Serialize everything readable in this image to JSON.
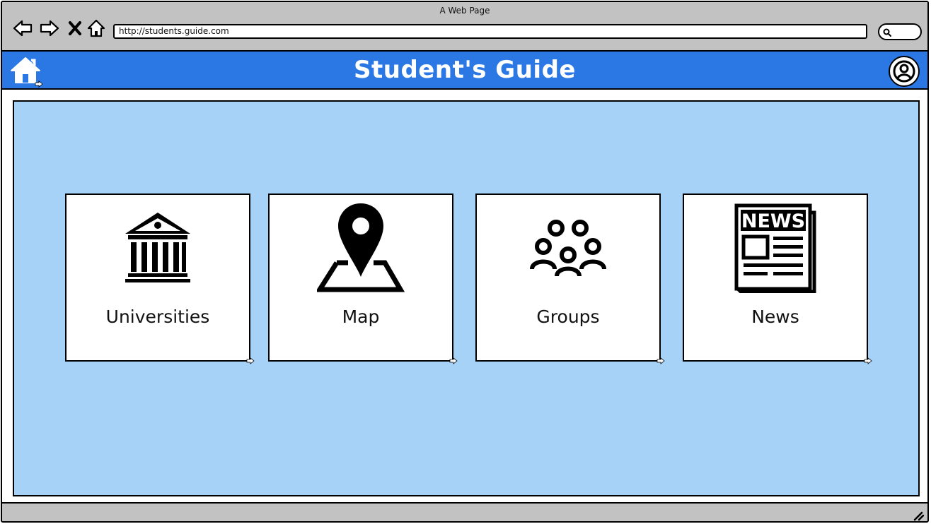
{
  "browser": {
    "window_title": "A Web Page",
    "url": "http://students.guide.com",
    "nav": {
      "back_icon": "arrow-left-icon",
      "forward_icon": "arrow-right-icon",
      "stop_icon": "close-icon",
      "home_icon": "home-icon",
      "search_icon": "search-icon"
    }
  },
  "header": {
    "title": "Student's Guide",
    "home_icon": "home-icon",
    "profile_icon": "user-circle-icon",
    "background_color": "#2b78e4"
  },
  "content": {
    "background_color": "#a7d2f7",
    "tiles": [
      {
        "label": "Universities",
        "icon": "university-building-icon"
      },
      {
        "label": "Map",
        "icon": "map-pin-icon"
      },
      {
        "label": "Groups",
        "icon": "people-group-icon"
      },
      {
        "label": "News",
        "icon": "newspaper-icon"
      }
    ]
  },
  "status_bar": {
    "resize_icon": "resize-grip-icon"
  }
}
